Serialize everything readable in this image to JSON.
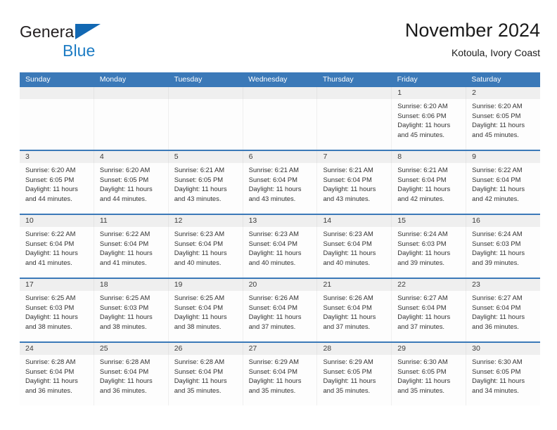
{
  "brand": {
    "name_part1": "General",
    "name_part2": "Blue",
    "triangle_icon": "blue-triangle-icon"
  },
  "header": {
    "title": "November 2024",
    "subtitle": "Kotoula, Ivory Coast"
  },
  "colors": {
    "header_blue": "#3b79b8",
    "brand_blue": "#1d7cc4",
    "date_band_gray": "#efefef",
    "text_dark": "#333333"
  },
  "day_names": [
    "Sunday",
    "Monday",
    "Tuesday",
    "Wednesday",
    "Thursday",
    "Friday",
    "Saturday"
  ],
  "weeks": [
    [
      {
        "day": "",
        "lines": []
      },
      {
        "day": "",
        "lines": []
      },
      {
        "day": "",
        "lines": []
      },
      {
        "day": "",
        "lines": []
      },
      {
        "day": "",
        "lines": []
      },
      {
        "day": "1",
        "lines": [
          "Sunrise: 6:20 AM",
          "Sunset: 6:06 PM",
          "Daylight: 11 hours",
          "and 45 minutes."
        ]
      },
      {
        "day": "2",
        "lines": [
          "Sunrise: 6:20 AM",
          "Sunset: 6:05 PM",
          "Daylight: 11 hours",
          "and 45 minutes."
        ]
      }
    ],
    [
      {
        "day": "3",
        "lines": [
          "Sunrise: 6:20 AM",
          "Sunset: 6:05 PM",
          "Daylight: 11 hours",
          "and 44 minutes."
        ]
      },
      {
        "day": "4",
        "lines": [
          "Sunrise: 6:20 AM",
          "Sunset: 6:05 PM",
          "Daylight: 11 hours",
          "and 44 minutes."
        ]
      },
      {
        "day": "5",
        "lines": [
          "Sunrise: 6:21 AM",
          "Sunset: 6:05 PM",
          "Daylight: 11 hours",
          "and 43 minutes."
        ]
      },
      {
        "day": "6",
        "lines": [
          "Sunrise: 6:21 AM",
          "Sunset: 6:04 PM",
          "Daylight: 11 hours",
          "and 43 minutes."
        ]
      },
      {
        "day": "7",
        "lines": [
          "Sunrise: 6:21 AM",
          "Sunset: 6:04 PM",
          "Daylight: 11 hours",
          "and 43 minutes."
        ]
      },
      {
        "day": "8",
        "lines": [
          "Sunrise: 6:21 AM",
          "Sunset: 6:04 PM",
          "Daylight: 11 hours",
          "and 42 minutes."
        ]
      },
      {
        "day": "9",
        "lines": [
          "Sunrise: 6:22 AM",
          "Sunset: 6:04 PM",
          "Daylight: 11 hours",
          "and 42 minutes."
        ]
      }
    ],
    [
      {
        "day": "10",
        "lines": [
          "Sunrise: 6:22 AM",
          "Sunset: 6:04 PM",
          "Daylight: 11 hours",
          "and 41 minutes."
        ]
      },
      {
        "day": "11",
        "lines": [
          "Sunrise: 6:22 AM",
          "Sunset: 6:04 PM",
          "Daylight: 11 hours",
          "and 41 minutes."
        ]
      },
      {
        "day": "12",
        "lines": [
          "Sunrise: 6:23 AM",
          "Sunset: 6:04 PM",
          "Daylight: 11 hours",
          "and 40 minutes."
        ]
      },
      {
        "day": "13",
        "lines": [
          "Sunrise: 6:23 AM",
          "Sunset: 6:04 PM",
          "Daylight: 11 hours",
          "and 40 minutes."
        ]
      },
      {
        "day": "14",
        "lines": [
          "Sunrise: 6:23 AM",
          "Sunset: 6:04 PM",
          "Daylight: 11 hours",
          "and 40 minutes."
        ]
      },
      {
        "day": "15",
        "lines": [
          "Sunrise: 6:24 AM",
          "Sunset: 6:03 PM",
          "Daylight: 11 hours",
          "and 39 minutes."
        ]
      },
      {
        "day": "16",
        "lines": [
          "Sunrise: 6:24 AM",
          "Sunset: 6:03 PM",
          "Daylight: 11 hours",
          "and 39 minutes."
        ]
      }
    ],
    [
      {
        "day": "17",
        "lines": [
          "Sunrise: 6:25 AM",
          "Sunset: 6:03 PM",
          "Daylight: 11 hours",
          "and 38 minutes."
        ]
      },
      {
        "day": "18",
        "lines": [
          "Sunrise: 6:25 AM",
          "Sunset: 6:03 PM",
          "Daylight: 11 hours",
          "and 38 minutes."
        ]
      },
      {
        "day": "19",
        "lines": [
          "Sunrise: 6:25 AM",
          "Sunset: 6:04 PM",
          "Daylight: 11 hours",
          "and 38 minutes."
        ]
      },
      {
        "day": "20",
        "lines": [
          "Sunrise: 6:26 AM",
          "Sunset: 6:04 PM",
          "Daylight: 11 hours",
          "and 37 minutes."
        ]
      },
      {
        "day": "21",
        "lines": [
          "Sunrise: 6:26 AM",
          "Sunset: 6:04 PM",
          "Daylight: 11 hours",
          "and 37 minutes."
        ]
      },
      {
        "day": "22",
        "lines": [
          "Sunrise: 6:27 AM",
          "Sunset: 6:04 PM",
          "Daylight: 11 hours",
          "and 37 minutes."
        ]
      },
      {
        "day": "23",
        "lines": [
          "Sunrise: 6:27 AM",
          "Sunset: 6:04 PM",
          "Daylight: 11 hours",
          "and 36 minutes."
        ]
      }
    ],
    [
      {
        "day": "24",
        "lines": [
          "Sunrise: 6:28 AM",
          "Sunset: 6:04 PM",
          "Daylight: 11 hours",
          "and 36 minutes."
        ]
      },
      {
        "day": "25",
        "lines": [
          "Sunrise: 6:28 AM",
          "Sunset: 6:04 PM",
          "Daylight: 11 hours",
          "and 36 minutes."
        ]
      },
      {
        "day": "26",
        "lines": [
          "Sunrise: 6:28 AM",
          "Sunset: 6:04 PM",
          "Daylight: 11 hours",
          "and 35 minutes."
        ]
      },
      {
        "day": "27",
        "lines": [
          "Sunrise: 6:29 AM",
          "Sunset: 6:04 PM",
          "Daylight: 11 hours",
          "and 35 minutes."
        ]
      },
      {
        "day": "28",
        "lines": [
          "Sunrise: 6:29 AM",
          "Sunset: 6:05 PM",
          "Daylight: 11 hours",
          "and 35 minutes."
        ]
      },
      {
        "day": "29",
        "lines": [
          "Sunrise: 6:30 AM",
          "Sunset: 6:05 PM",
          "Daylight: 11 hours",
          "and 35 minutes."
        ]
      },
      {
        "day": "30",
        "lines": [
          "Sunrise: 6:30 AM",
          "Sunset: 6:05 PM",
          "Daylight: 11 hours",
          "and 34 minutes."
        ]
      }
    ]
  ]
}
